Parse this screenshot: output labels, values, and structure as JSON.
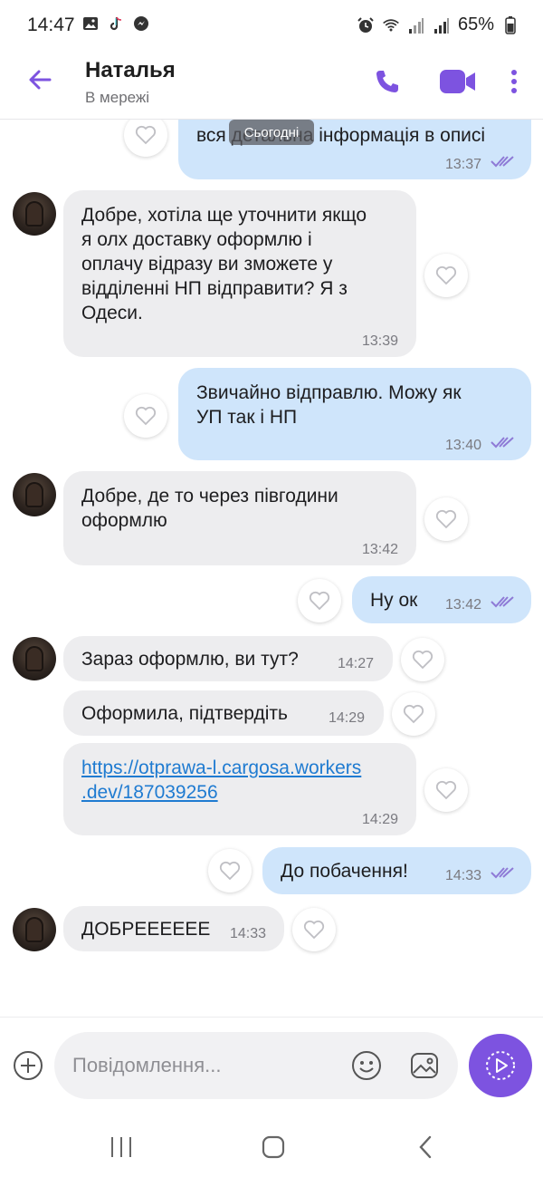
{
  "status_bar": {
    "time": "14:47",
    "battery": "65%",
    "left_icons": [
      "gallery-icon",
      "tiktok-icon",
      "messenger-icon"
    ],
    "right_icons": [
      "alarm-icon",
      "wifi-icon",
      "signal-icon",
      "signal-icon",
      "battery-icon"
    ]
  },
  "header": {
    "contact_name": "Наталья",
    "contact_status": "В мережі",
    "accent_color": "#7d53e0"
  },
  "chat": {
    "date_separator": "Сьогодні",
    "messages": [
      {
        "dir": "out",
        "text": "вся детальна інформація в описі",
        "time": "13:37",
        "read": true
      },
      {
        "dir": "in",
        "text": "Добре, хотіла ще уточнити якщо\nя олх доставку оформлю і\nоплачу відразу ви зможете у\nвідділенні НП відправити? Я з\nОдеси.",
        "time": "13:39"
      },
      {
        "dir": "out",
        "text": "Звичайно відправлю. Можу як\nУП так і НП",
        "time": "13:40",
        "read": true
      },
      {
        "dir": "in",
        "text": "Добре, де то через півгодини\nоформлю",
        "time": "13:42"
      },
      {
        "dir": "out",
        "text": "Ну ок",
        "time": "13:42",
        "read": true
      },
      {
        "dir": "in",
        "text": "Зараз оформлю, ви тут?",
        "time": "14:27"
      },
      {
        "dir": "in",
        "text": "Оформила, підтвердіть",
        "time": "14:29"
      },
      {
        "dir": "in",
        "text": "https://otprawa-l.cargosa.workers\n.dev/187039256",
        "time": "14:29",
        "is_link": true
      },
      {
        "dir": "out",
        "text": "До побачення!",
        "time": "14:33",
        "read": true
      },
      {
        "dir": "in",
        "text": "ДОБРЕЕЕЕЕЕ",
        "time": "14:33"
      }
    ]
  },
  "composer": {
    "placeholder": "Повідомлення...",
    "icons": [
      "plus-icon",
      "emoji-icon",
      "gallery-icon",
      "send-icon"
    ]
  },
  "nav_bar": {
    "icons": [
      "recent-apps-icon",
      "home-icon",
      "back-icon"
    ]
  }
}
